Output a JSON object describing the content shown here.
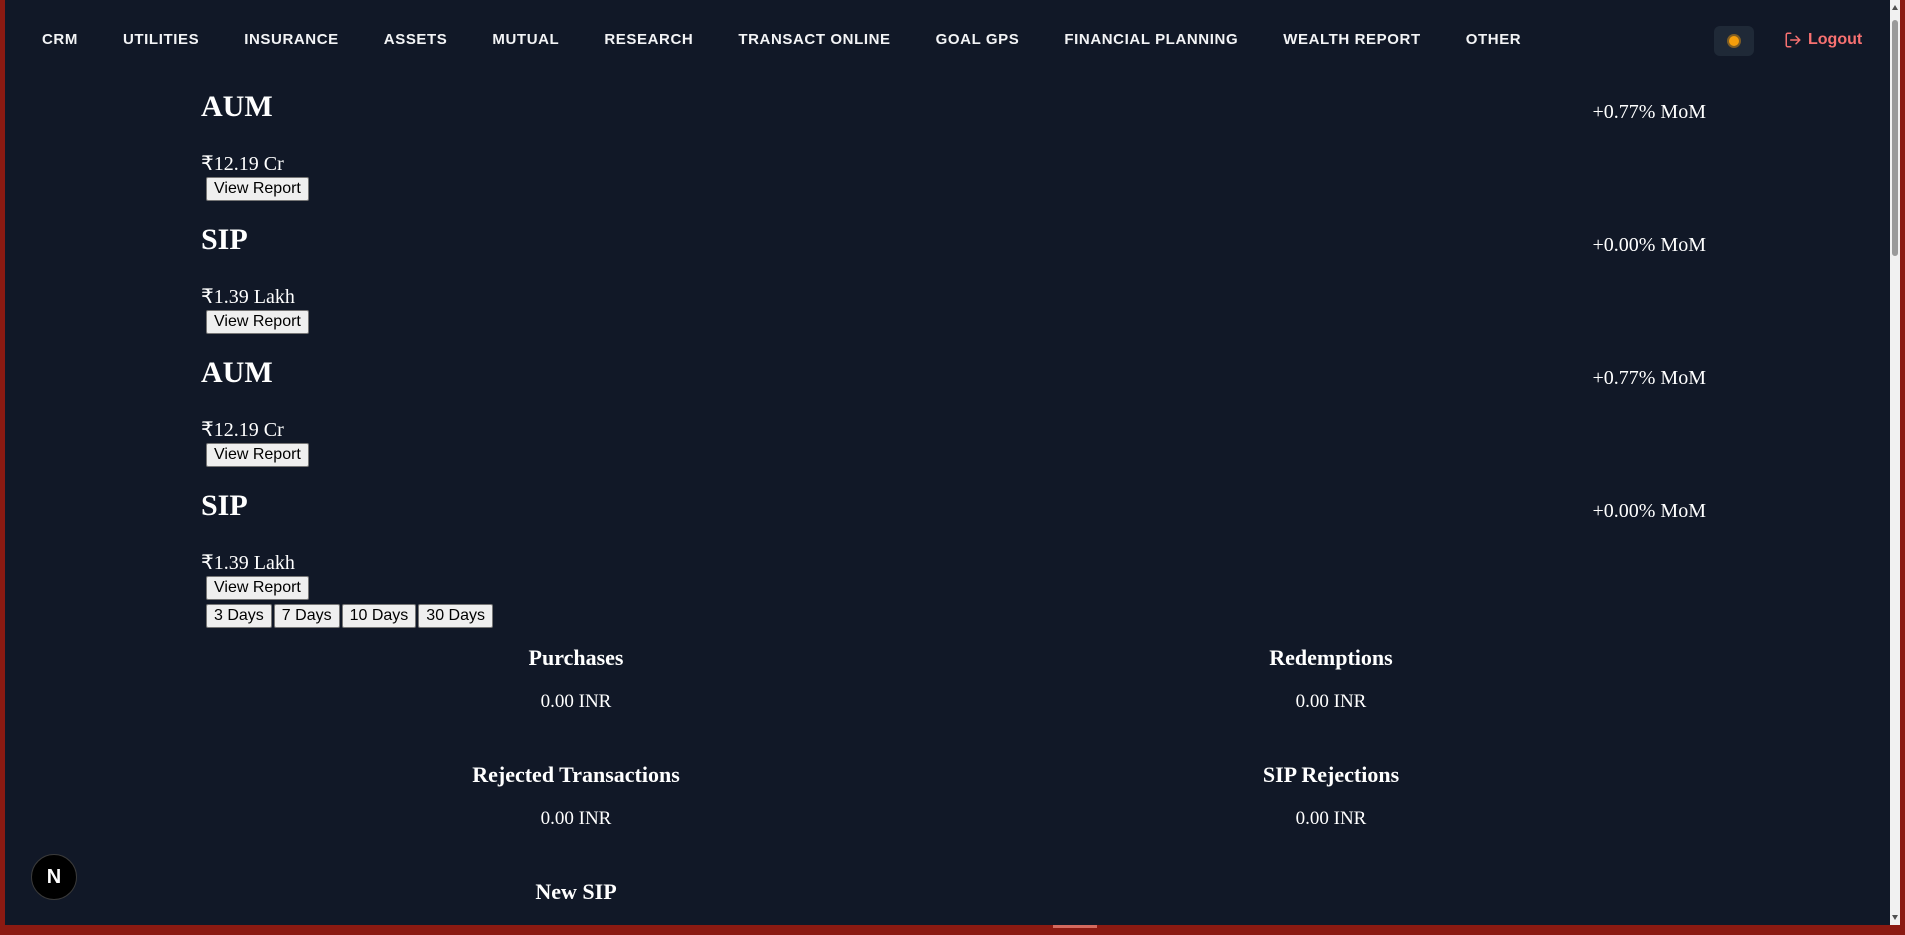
{
  "nav": {
    "links": [
      "CRM",
      "UTILITIES",
      "INSURANCE",
      "ASSETS",
      "MUTUAL",
      "RESEARCH",
      "TRANSACT ONLINE",
      "GOAL GPS",
      "FINANCIAL PLANNING",
      "WEALTH REPORT",
      "OTHER"
    ],
    "theme_icon": "sun-icon",
    "logout_label": "Logout",
    "logout_icon": "logout-icon"
  },
  "metrics": [
    {
      "title": "AUM",
      "change": "+0.77% MoM",
      "value": "₹12.19 Cr",
      "button": "View Report"
    },
    {
      "title": "SIP",
      "change": "+0.00% MoM",
      "value": "₹1.39 Lakh",
      "button": "View Report"
    },
    {
      "title": "AUM",
      "change": "+0.77% MoM",
      "value": "₹12.19 Cr",
      "button": "View Report"
    },
    {
      "title": "SIP",
      "change": "+0.00% MoM",
      "value": "₹1.39 Lakh",
      "button": "View Report"
    }
  ],
  "day_filters": [
    "3 Days",
    "7 Days",
    "10 Days",
    "30 Days"
  ],
  "stats": [
    {
      "title": "Purchases",
      "value": "0.00 INR"
    },
    {
      "title": "Redemptions",
      "value": "0.00 INR"
    },
    {
      "title": "Rejected Transactions",
      "value": "0.00 INR"
    },
    {
      "title": "SIP Rejections",
      "value": "0.00 INR"
    },
    {
      "title": "New SIP",
      "value": ""
    }
  ],
  "badge_letter": "N",
  "colors": {
    "background": "#111827",
    "logout": "#f87171",
    "theme_icon": "#f59e0b",
    "frame": "#8b1a12"
  }
}
